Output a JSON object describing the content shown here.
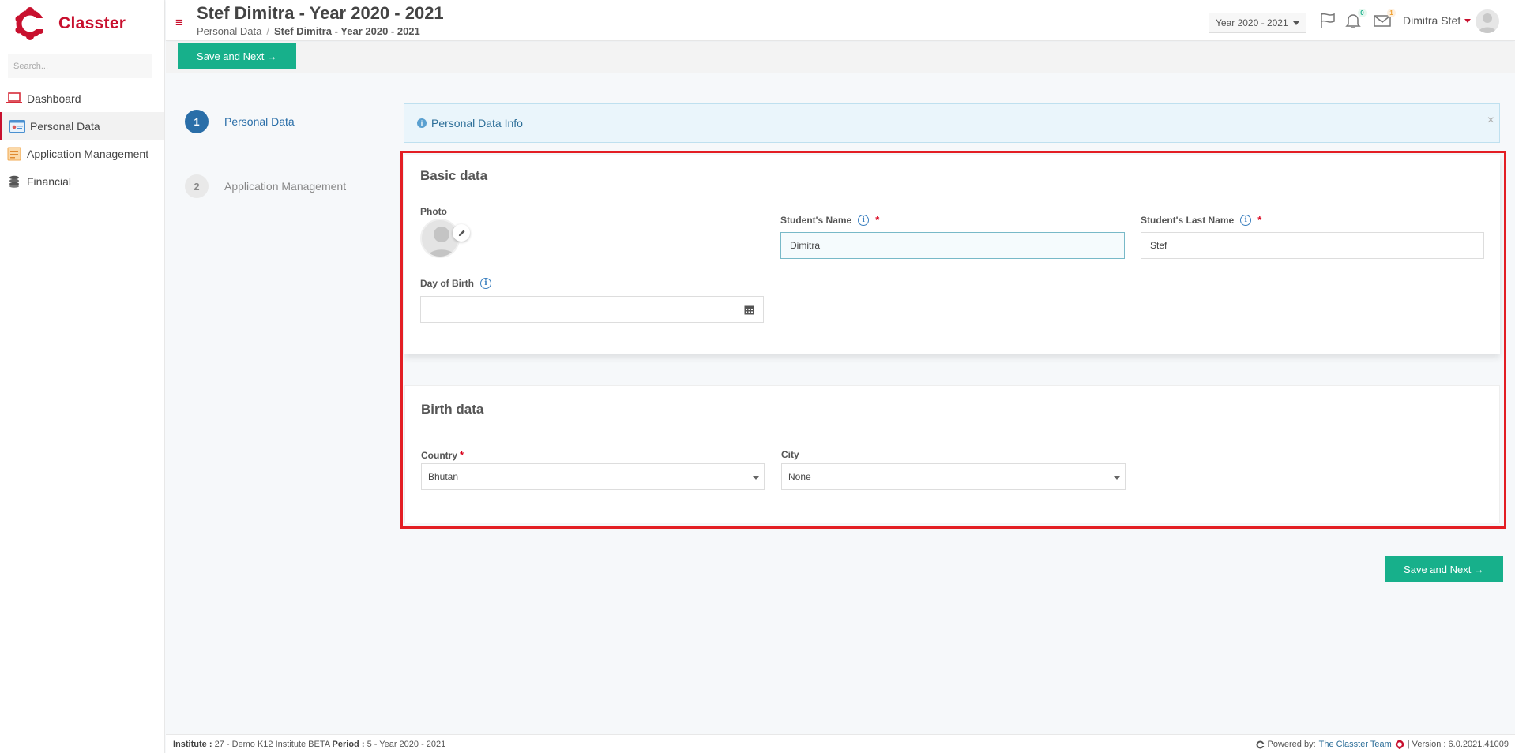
{
  "brand": {
    "name": "Classter",
    "color": "#c8102e"
  },
  "sidebar": {
    "search_placeholder": "Search...",
    "items": [
      {
        "label": "Dashboard",
        "icon": "laptop-icon"
      },
      {
        "label": "Personal Data",
        "icon": "id-card-icon",
        "active": true
      },
      {
        "label": "Application Management",
        "icon": "document-icon"
      },
      {
        "label": "Financial",
        "icon": "coins-icon"
      }
    ]
  },
  "header": {
    "title": "Stef Dimitra - Year 2020 - 2021",
    "breadcrumb": [
      "Personal Data",
      "Stef Dimitra - Year 2020 - 2021"
    ],
    "year_select": "Year 2020 - 2021",
    "notifications_count": "0",
    "messages_count": "1",
    "user_name": "Dimitra Stef"
  },
  "actions": {
    "save_next_label": "Save and Next →",
    "accent": "#17b08b"
  },
  "steps": [
    {
      "number": "1",
      "label": "Personal Data",
      "active": true
    },
    {
      "number": "2",
      "label": "Application Management",
      "active": false
    }
  ],
  "alert": {
    "text": "Personal Data Info",
    "close": "×"
  },
  "basic_data": {
    "title": "Basic data",
    "photo_label": "Photo",
    "name_label": "Student's Name",
    "name_value": "Dimitra",
    "last_name_label": "Student's Last Name",
    "last_name_value": "Stef",
    "dob_label": "Day of Birth",
    "dob_value": "",
    "required_mark": "*"
  },
  "birth_data": {
    "title": "Birth data",
    "country_label": "Country",
    "country_value": "Bhutan",
    "city_label": "City",
    "city_value": "None",
    "required_mark": "*"
  },
  "footer": {
    "institute_label": "Institute :",
    "institute_value": "27 - Demo K12 Institute BETA",
    "period_label": "Period :",
    "period_value": "5 - Year 2020 - 2021",
    "powered_by": "Powered by:",
    "team": "The Classter Team",
    "version": "| Version : 6.0.2021.41009"
  }
}
